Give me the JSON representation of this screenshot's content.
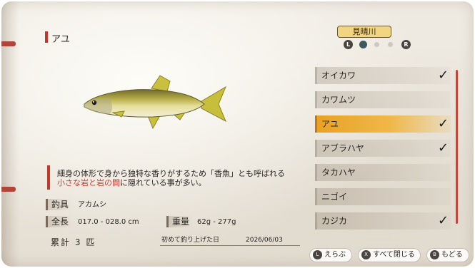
{
  "fish": {
    "name": "アユ",
    "description_line1": "細身の体形で身から独特な香りがするため「香魚」とも呼ばれる",
    "description_line2_highlight": "小さな岩と岩の間",
    "description_line2_rest": "に隠れている事が多い。"
  },
  "stats": {
    "tackle_label": "釣具",
    "tackle_value": "アカムシ",
    "length_label": "全長",
    "length_value": "017.0 - 028.0 cm",
    "weight_label": "重量",
    "weight_value": "62g - 277g",
    "total_label": "累計",
    "total_count": "3",
    "total_unit": "匹",
    "first_caught_label": "初めて釣り上げた日",
    "first_caught_date": "2026/06/03"
  },
  "location": {
    "name": "見晴川",
    "left_button": "L",
    "right_button": "R"
  },
  "list": {
    "items": [
      {
        "label": "オイカワ",
        "caught": true
      },
      {
        "label": "カワムツ",
        "caught": false
      },
      {
        "label": "アユ",
        "caught": true
      },
      {
        "label": "アブラハヤ",
        "caught": true
      },
      {
        "label": "タカハヤ",
        "caught": false
      },
      {
        "label": "ニゴイ",
        "caught": false
      },
      {
        "label": "カジカ",
        "caught": true
      }
    ],
    "check_glyph": "✓"
  },
  "footer": {
    "select_button": "L",
    "select_label": "えらぶ",
    "close_button": "X",
    "close_label": "すべて閉じる",
    "back_button": "B",
    "back_label": "もどる"
  }
}
